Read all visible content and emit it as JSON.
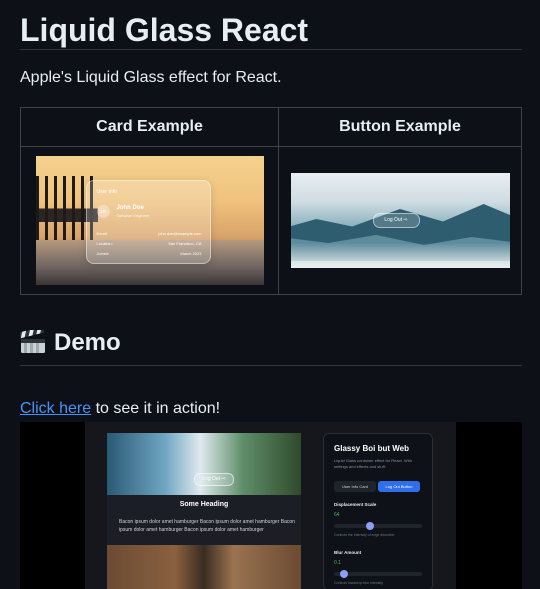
{
  "title": "Liquid Glass React",
  "intro": "Apple's Liquid Glass effect for React.",
  "examples_table": {
    "headers": [
      "Card Example",
      "Button Example"
    ],
    "card": {
      "title": "User Info",
      "initials": "JD",
      "name": "John Doe",
      "role": "Software Engineer",
      "rows": [
        {
          "label": "Email:",
          "value": "john.doe@example.com"
        },
        {
          "label": "Location:",
          "value": "San Francisco, CA"
        },
        {
          "label": "Joined:",
          "value": "March 2023"
        }
      ]
    },
    "button": {
      "label": "Log Out ⇨"
    }
  },
  "demo_section": {
    "heading": "Demo",
    "link_text": "Click here",
    "link_suffix": " to see it in action!"
  },
  "demo_screenshot": {
    "logout_label": "Log Out ⇨",
    "heading": "Some Heading",
    "body": "Bacon ipsum dolor amet hamburger Bacon ipsum dolor amet hamburger Bacon ipsum dolor amet hamburger Bacon ipsum dolor amet hamburger",
    "panel": {
      "title": "Glassy Boi but Web",
      "description": "Liquid Glass container effect for React. With settings and effects and stuff.",
      "tab_inactive": "User Info Card",
      "tab_active": "Log Out Button",
      "displacement": {
        "label": "Displacement Scale",
        "value": "64",
        "help": "Controls the intensity of edge distortion",
        "level": 0.4
      },
      "blur": {
        "label": "Blur Amount",
        "value": "0.1",
        "help": "Controls backdrop blur intensity",
        "level": 0.08
      }
    }
  },
  "colors": {
    "background": "#0d1117",
    "link": "#4493f8",
    "text": "#e6edf3"
  }
}
